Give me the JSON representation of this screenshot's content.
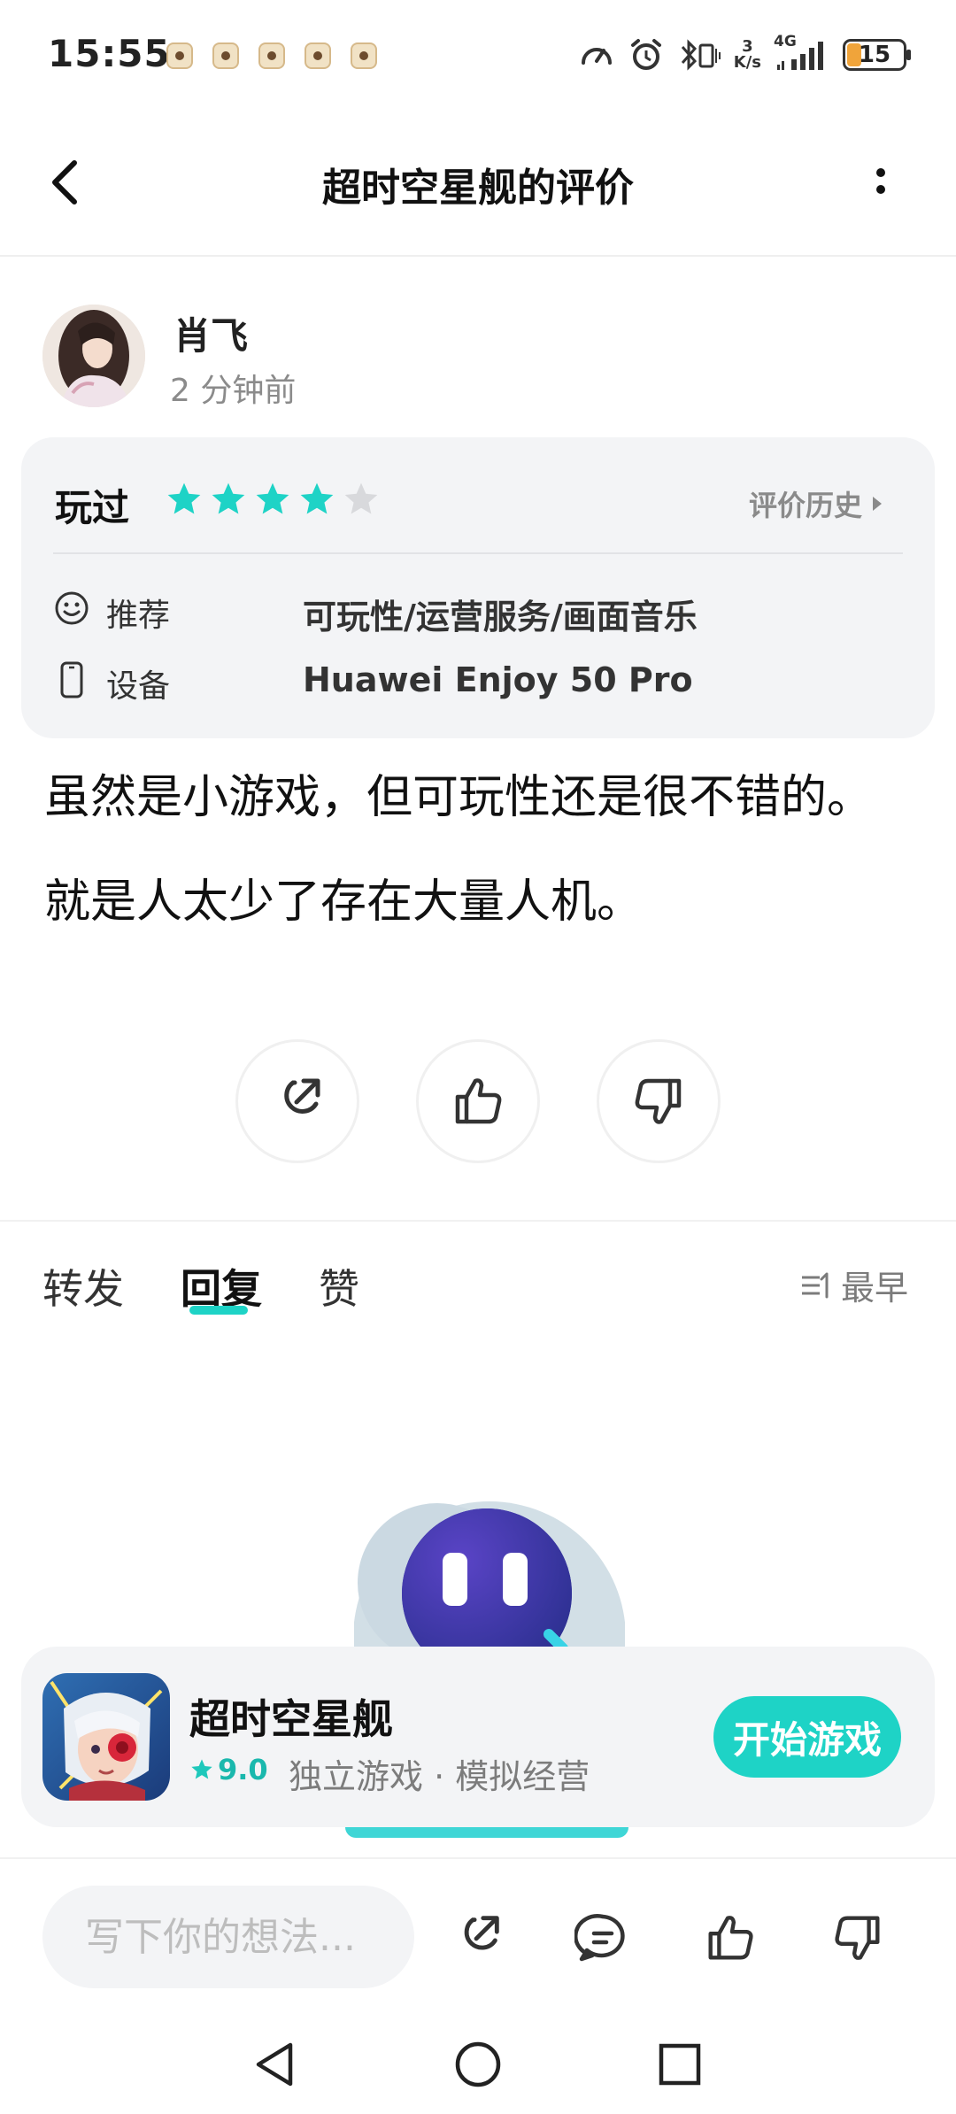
{
  "status_bar": {
    "time": "15:55",
    "network_speed_value": "3",
    "network_speed_unit": "K/s",
    "network_type": "4G",
    "battery": "15"
  },
  "header": {
    "title": "超时空星舰的评价"
  },
  "review": {
    "username": "肖飞",
    "time": "2 分钟前",
    "status": "玩过",
    "rating": 4,
    "rating_max": 5,
    "history_label": "评价历史",
    "recommend_label": "推荐",
    "recommend_value": "可玩性/运营服务/画面音乐",
    "device_label": "设备",
    "device_value": "Huawei Enjoy 50 Pro",
    "text": "虽然是小游戏，但可玩性还是很不错的。就是人太少了存在大量人机。"
  },
  "tabs": {
    "forward": "转发",
    "reply": "回复",
    "like": "赞",
    "sort": "最早"
  },
  "game": {
    "name": "超时空星舰",
    "rating": "9.0",
    "tags": "独立游戏 · 模拟经营",
    "play_button": "开始游戏"
  },
  "bottom_bar": {
    "placeholder": "写下你的想法..."
  },
  "colors": {
    "accent": "#1ed3c6",
    "star_empty": "#d8d9dc"
  }
}
